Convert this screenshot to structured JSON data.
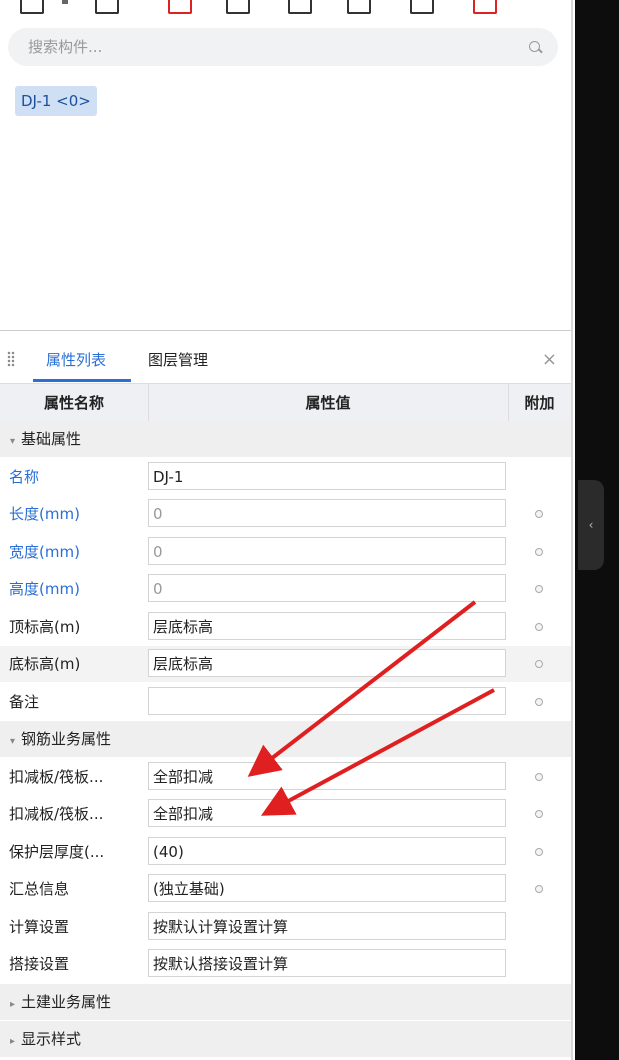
{
  "search": {
    "placeholder": "搜索构件..."
  },
  "components": [
    {
      "label": "DJ-1 <0>"
    }
  ],
  "tabs": [
    {
      "label": "属性列表",
      "active": true
    },
    {
      "label": "图层管理",
      "active": false
    }
  ],
  "table": {
    "headers": [
      "属性名称",
      "属性值",
      "附加"
    ],
    "groups": [
      {
        "label": "基础属性",
        "expanded": true,
        "rows": [
          {
            "name": "名称",
            "value": "DJ-1",
            "blue": true,
            "muted": false,
            "dot": false
          },
          {
            "name": "长度(mm)",
            "value": "0",
            "blue": true,
            "muted": true,
            "dot": true
          },
          {
            "name": "宽度(mm)",
            "value": "0",
            "blue": true,
            "muted": true,
            "dot": true
          },
          {
            "name": "高度(mm)",
            "value": "0",
            "blue": true,
            "muted": true,
            "dot": true
          },
          {
            "name": "顶标高(m)",
            "value": "层底标高",
            "blue": false,
            "muted": false,
            "dot": true
          },
          {
            "name": "底标高(m)",
            "value": "层底标高",
            "blue": false,
            "muted": false,
            "dot": true
          },
          {
            "name": "备注",
            "value": "",
            "blue": false,
            "muted": false,
            "dot": true
          }
        ]
      },
      {
        "label": "钢筋业务属性",
        "expanded": true,
        "rows": [
          {
            "name": "扣减板/筏板...",
            "value": "全部扣减",
            "blue": false,
            "muted": false,
            "dot": true
          },
          {
            "name": "扣减板/筏板...",
            "value": "全部扣减",
            "blue": false,
            "muted": false,
            "dot": true
          },
          {
            "name": "保护层厚度(...",
            "value": "(40)",
            "blue": false,
            "muted": false,
            "dot": true
          },
          {
            "name": "汇总信息",
            "value": "(独立基础)",
            "blue": false,
            "muted": false,
            "dot": true
          },
          {
            "name": "计算设置",
            "value": "按默认计算设置计算",
            "blue": false,
            "muted": false,
            "dot": false
          },
          {
            "name": "搭接设置",
            "value": "按默认搭接设置计算",
            "blue": false,
            "muted": false,
            "dot": false
          }
        ]
      },
      {
        "label": "土建业务属性",
        "expanded": false,
        "rows": []
      },
      {
        "label": "显示样式",
        "expanded": false,
        "rows": []
      }
    ]
  },
  "colors": {
    "accent": "#2a6fd6",
    "annotation": "#e02020"
  },
  "icons": [
    "dropdown-caret-icon",
    "new-icon",
    "delete-icon",
    "copy-icon",
    "layer-copy-icon",
    "rename-icon",
    "list-icon",
    "import-icon",
    "search-icon",
    "close-icon",
    "collapse-arrow-icon"
  ]
}
